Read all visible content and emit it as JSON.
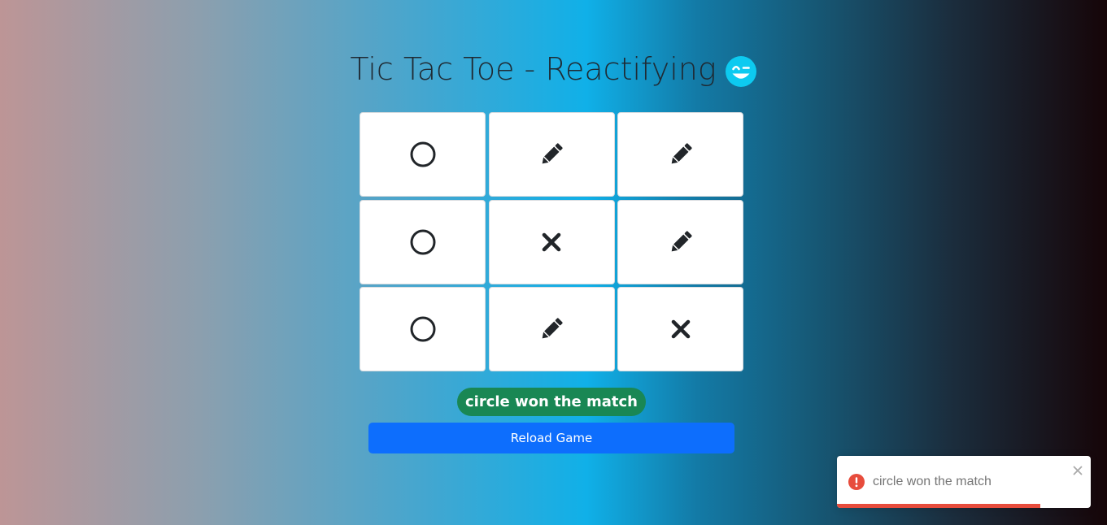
{
  "header": {
    "title": "Tic Tac Toe - Reactifying",
    "emoji_icon": "winking-face-icon"
  },
  "board": {
    "cells": [
      {
        "state": "circle",
        "icon": "circle-icon"
      },
      {
        "state": "empty",
        "icon": "pencil-icon"
      },
      {
        "state": "empty",
        "icon": "pencil-icon"
      },
      {
        "state": "circle",
        "icon": "circle-icon"
      },
      {
        "state": "cross",
        "icon": "cross-icon"
      },
      {
        "state": "empty",
        "icon": "pencil-icon"
      },
      {
        "state": "circle",
        "icon": "circle-icon"
      },
      {
        "state": "empty",
        "icon": "pencil-icon"
      },
      {
        "state": "cross",
        "icon": "cross-icon"
      }
    ]
  },
  "status": {
    "message": "circle won the match",
    "color": "#198754"
  },
  "actions": {
    "reload_label": "Reload Game",
    "color": "#0d6efd"
  },
  "toast": {
    "message": "circle won the match",
    "type": "error",
    "status_icon": "error-icon",
    "close_icon": "close-icon",
    "progress": 0.8,
    "color": "#e74c3c"
  }
}
